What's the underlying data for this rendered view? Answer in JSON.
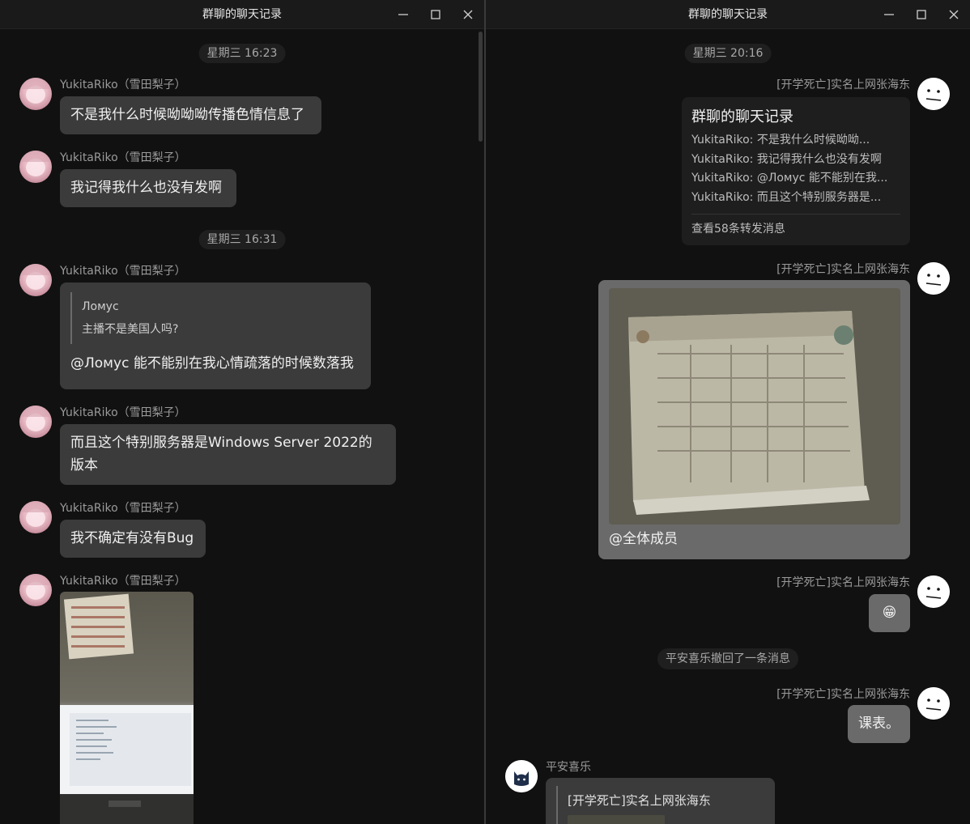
{
  "left_window": {
    "title": "群聊的聊天记录",
    "timestamps": [
      "星期三 16:23",
      "星期三 16:31"
    ],
    "messages": [
      {
        "sender": "YukitaRiko（雪田梨子）",
        "text": "不是我什么时候呦呦呦传播色情信息了"
      },
      {
        "sender": "YukitaRiko（雪田梨子）",
        "text": "我记得我什么也没有发啊"
      },
      {
        "sender": "YukitaRiko（雪田梨子）",
        "quote_author": "Ломус",
        "quote_text": "主播不是美国人吗?",
        "text": "@Ломус 能不能别在我心情疏落的时候数落我"
      },
      {
        "sender": "YukitaRiko（雪田梨子）",
        "text_line1": "而且这个特别服务器是Windows Server 2022的",
        "text_line2": "版本"
      },
      {
        "sender": "YukitaRiko（雪田梨子）",
        "text": "我不确定有没有Bug"
      },
      {
        "sender": "YukitaRiko（雪田梨子）"
      }
    ]
  },
  "right_window": {
    "title": "群聊的聊天记录",
    "timestamp": "星期三 20:16",
    "sender_main": "[开学死亡]实名上网张海东",
    "forward": {
      "title": "群聊的聊天记录",
      "lines": [
        "YukitaRiko: 不是我什么时候呦呦...",
        "YukitaRiko: 我记得我什么也没有发啊",
        "YukitaRiko: @Ломус 能不能别在我...",
        "YukitaRiko: 而且这个特别服务器是..."
      ],
      "footer": "查看58条转发消息"
    },
    "image_caption": "@全体成员",
    "emoji": "😁",
    "recall_notice": "平安喜乐撤回了一条消息",
    "last_text": "课表。",
    "sender_cat": "平安喜乐",
    "quote_author_cat": "[开学死亡]实名上网张海东"
  },
  "icons": [
    "minimize-icon",
    "maximize-icon",
    "close-icon"
  ]
}
